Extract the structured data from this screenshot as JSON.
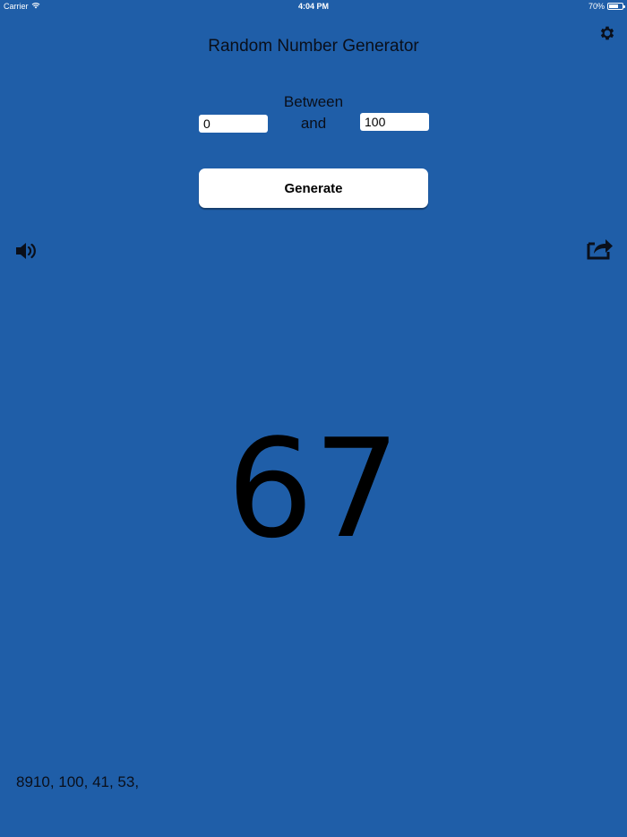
{
  "status_bar": {
    "carrier": "Carrier",
    "time": "4:04 PM",
    "battery": "70%",
    "battery_level": 0.7
  },
  "icons": {
    "settings": "gear-icon",
    "sound": "speaker-icon",
    "share": "share-icon",
    "wifi": "wifi-icon",
    "battery": "battery-icon"
  },
  "app": {
    "title": "Random Number Generator"
  },
  "range": {
    "between_label": "Between",
    "and_label": "and",
    "min_value": "0",
    "max_value": "100"
  },
  "actions": {
    "generate_label": "Generate"
  },
  "result": {
    "value": "67"
  },
  "history": {
    "text": "8910, 100, 41, 53,"
  },
  "colors": {
    "background": "#1f5ea8",
    "text": "#0a0f1a",
    "button_bg": "#ffffff"
  }
}
